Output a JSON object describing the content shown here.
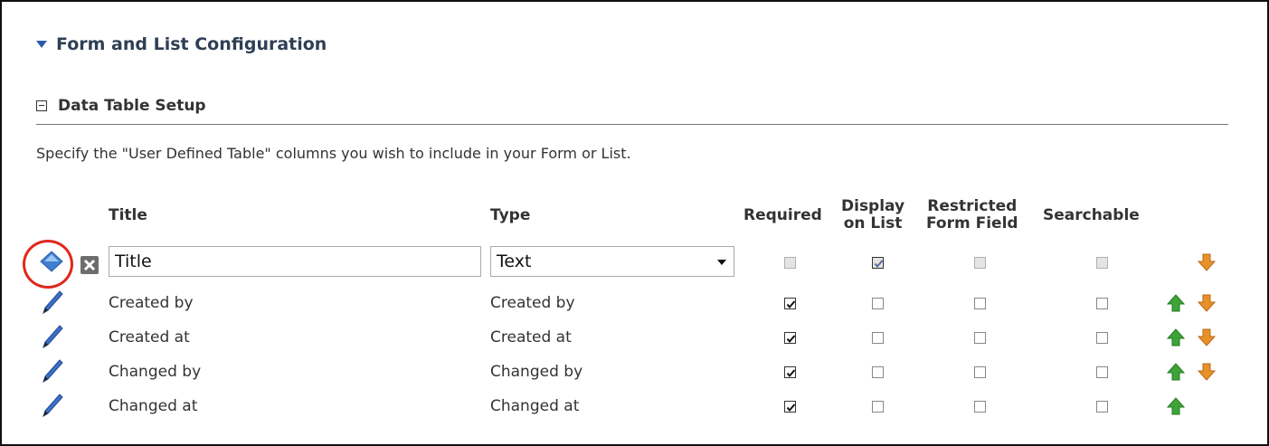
{
  "section": {
    "title": "Form and List Configuration"
  },
  "subsection": {
    "title": "Data Table Setup"
  },
  "description": "Specify the \"User Defined Table\" columns you wish to include in your Form or List.",
  "columns": {
    "title": "Title",
    "type": "Type",
    "required": "Required",
    "display_line1": "Display",
    "display_line2": "on List",
    "restricted_line1": "Restricted",
    "restricted_line2": "Form Field",
    "searchable": "Searchable"
  },
  "edit_row": {
    "title_value": "Title",
    "type_value": "Text",
    "required": false,
    "display_on_list": true,
    "restricted": false,
    "searchable": false
  },
  "rows": [
    {
      "title": "Created by",
      "type": "Created by",
      "required": true,
      "display_on_list": false,
      "restricted": false,
      "searchable": false
    },
    {
      "title": "Created at",
      "type": "Created at",
      "required": true,
      "display_on_list": false,
      "restricted": false,
      "searchable": false
    },
    {
      "title": "Changed by",
      "type": "Changed by",
      "required": true,
      "display_on_list": false,
      "restricted": false,
      "searchable": false
    },
    {
      "title": "Changed at",
      "type": "Changed at",
      "required": true,
      "display_on_list": false,
      "restricted": false,
      "searchable": false
    }
  ],
  "colors": {
    "header_text": "#2e3f55",
    "triangle": "#2b5aa8",
    "highlight": "#e0281e",
    "up_arrow": "#3ea43a",
    "down_arrow": "#e8902a"
  }
}
